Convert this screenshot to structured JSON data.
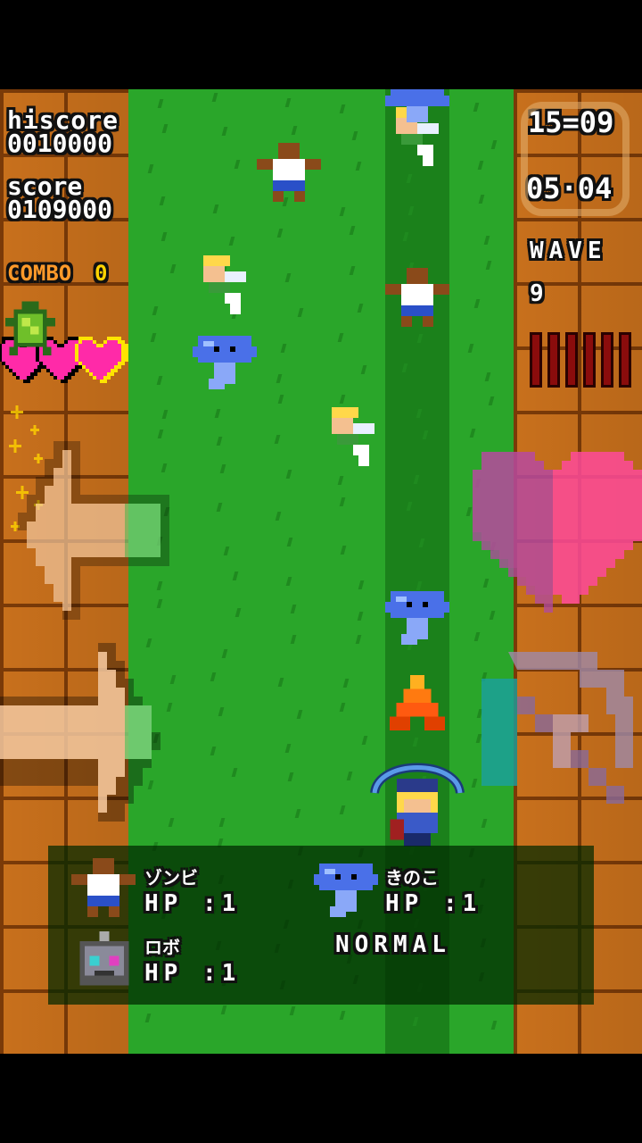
{
  "hud": {
    "hiscore_label": "hiscore",
    "hiscore_value": "0010000",
    "score_label": "score",
    "score_value": "0109000",
    "combo_label": "COMBO",
    "combo_value": "0",
    "time": "15=09",
    "kills": "05·04",
    "wave_label": "WAVE",
    "wave_value": "9",
    "lives": 3,
    "hp_bars": 6
  },
  "controls": {
    "left_icon": "arrow-left-icon",
    "right_icon": "arrow-right-icon",
    "heart_icon": "heart-icon",
    "bow_icon": "crossbow-icon"
  },
  "info_panel": {
    "enemies": [
      {
        "name": "ゾンビ",
        "hp": "HP :1",
        "icon": "zombie-icon"
      },
      {
        "name": "きのこ",
        "hp": "HP :1",
        "icon": "mushroom-icon"
      },
      {
        "name": "ロボ",
        "hp": "HP :1",
        "icon": "robot-icon"
      }
    ],
    "difficulty": "NORMAL"
  },
  "colors": {
    "wall": "#c8701c",
    "grass": "#2aa62a",
    "heart": "#ff2aa8",
    "hp_bar": "#8a0c0c",
    "combo": "#ff9a2a"
  }
}
